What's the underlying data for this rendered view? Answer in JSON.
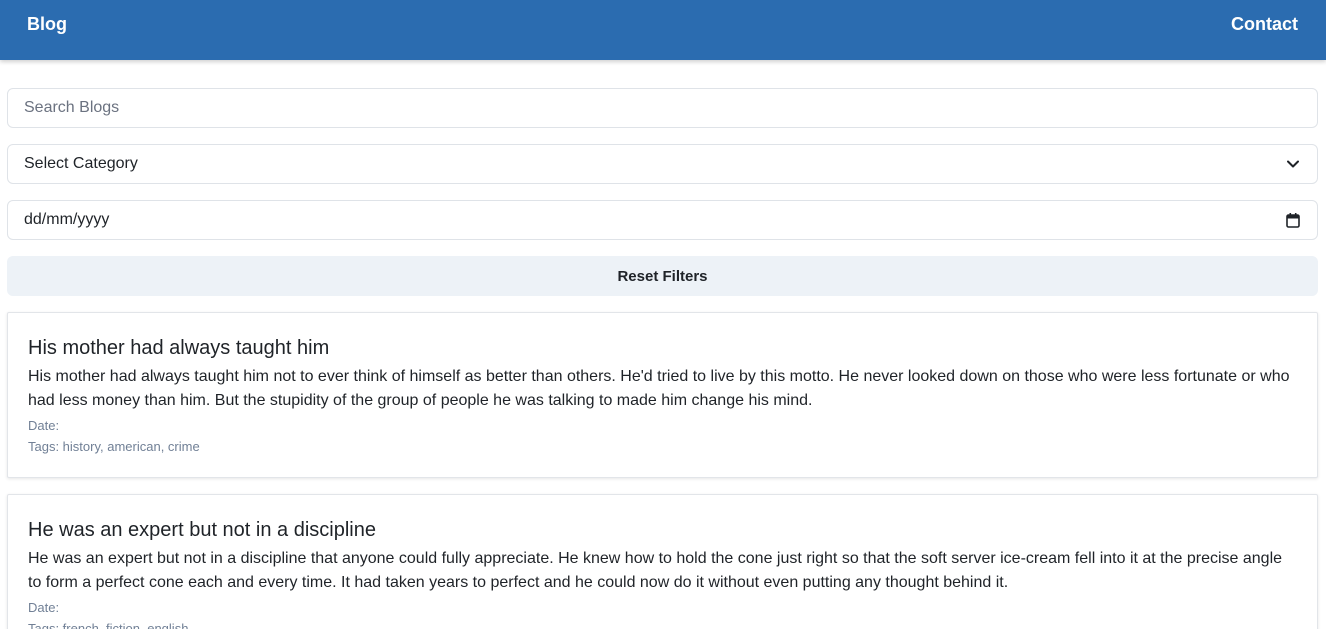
{
  "nav": {
    "brand": "Blog",
    "contact": "Contact"
  },
  "filters": {
    "search_placeholder": "Search Blogs",
    "category_value": "Select Category",
    "date_placeholder": "dd/mm/yyyy",
    "reset_label": "Reset Filters"
  },
  "posts": [
    {
      "title": "His mother had always taught him",
      "body": "His mother had always taught him not to ever think of himself as better than others. He'd tried to live by this motto. He never looked down on those who were less fortunate or who had less money than him. But the stupidity of the group of people he was talking to made him change his mind.",
      "date": "Date:",
      "tags": "Tags: history, american, crime"
    },
    {
      "title": "He was an expert but not in a discipline",
      "body": "He was an expert but not in a discipline that anyone could fully appreciate. He knew how to hold the cone just right so that the soft server ice-cream fell into it at the precise angle to form a perfect cone each and every time. It had taken years to perfect and he could now do it without even putting any thought behind it.",
      "date": "Date:",
      "tags": "Tags: french, fiction, english"
    }
  ],
  "icons": {
    "select": "chevron-down-icon",
    "date": "calendar-icon"
  },
  "colors": {
    "navbar": "#2b6cb0",
    "reset_button": "#edf2f7",
    "meta_text": "#718096"
  }
}
